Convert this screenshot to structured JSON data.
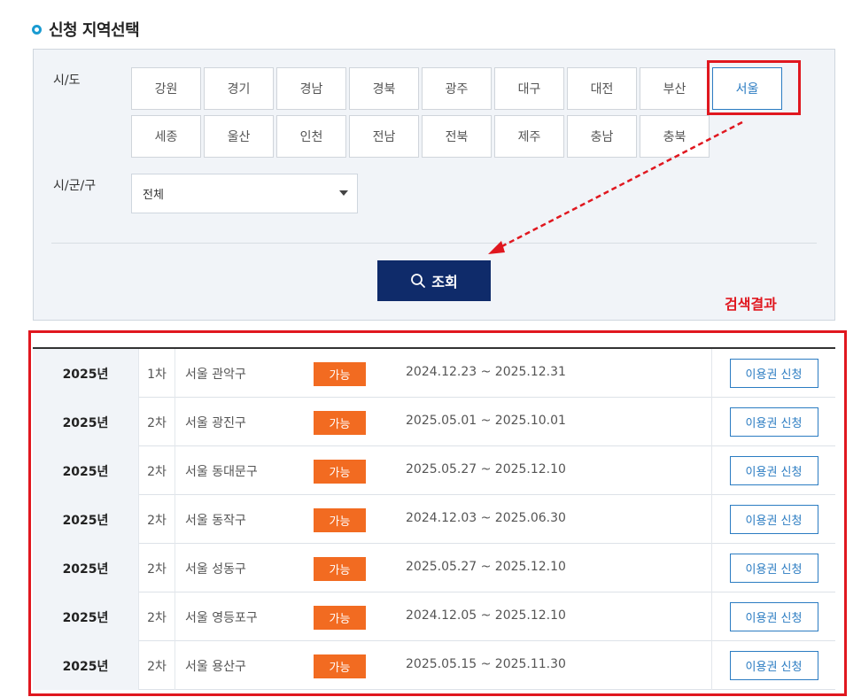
{
  "section": {
    "title": "신청 지역선택"
  },
  "filter": {
    "sido_label": "시/도",
    "sigungu_label": "시/군/구",
    "regions_row1": [
      "강원",
      "경기",
      "경남",
      "경북",
      "광주",
      "대구",
      "대전",
      "부산",
      "서울"
    ],
    "regions_row2": [
      "세종",
      "울산",
      "인천",
      "전남",
      "전북",
      "제주",
      "충남",
      "충북"
    ],
    "selected_region": "서울",
    "district_select_value": "전체",
    "search_button": "조회"
  },
  "annotation": {
    "results_label": "검색결과",
    "highlight_color": "#e0171f"
  },
  "results": {
    "status_color": "#f26b21",
    "rows": [
      {
        "year": "2025년",
        "round": "1차",
        "region": "서울 관악구",
        "status": "가능",
        "period": "2024.12.23 ~ 2025.12.31",
        "action": "이용권 신청"
      },
      {
        "year": "2025년",
        "round": "2차",
        "region": "서울 광진구",
        "status": "가능",
        "period": "2025.05.01 ~ 2025.10.01",
        "action": "이용권 신청"
      },
      {
        "year": "2025년",
        "round": "2차",
        "region": "서울 동대문구",
        "status": "가능",
        "period": "2025.05.27 ~ 2025.12.10",
        "action": "이용권 신청"
      },
      {
        "year": "2025년",
        "round": "2차",
        "region": "서울 동작구",
        "status": "가능",
        "period": "2024.12.03 ~ 2025.06.30",
        "action": "이용권 신청"
      },
      {
        "year": "2025년",
        "round": "2차",
        "region": "서울 성동구",
        "status": "가능",
        "period": "2025.05.27 ~ 2025.12.10",
        "action": "이용권 신청"
      },
      {
        "year": "2025년",
        "round": "2차",
        "region": "서울 영등포구",
        "status": "가능",
        "period": "2024.12.05 ~ 2025.12.10",
        "action": "이용권 신청"
      },
      {
        "year": "2025년",
        "round": "2차",
        "region": "서울 용산구",
        "status": "가능",
        "period": "2025.05.15 ~ 2025.11.30",
        "action": "이용권 신청"
      }
    ]
  }
}
